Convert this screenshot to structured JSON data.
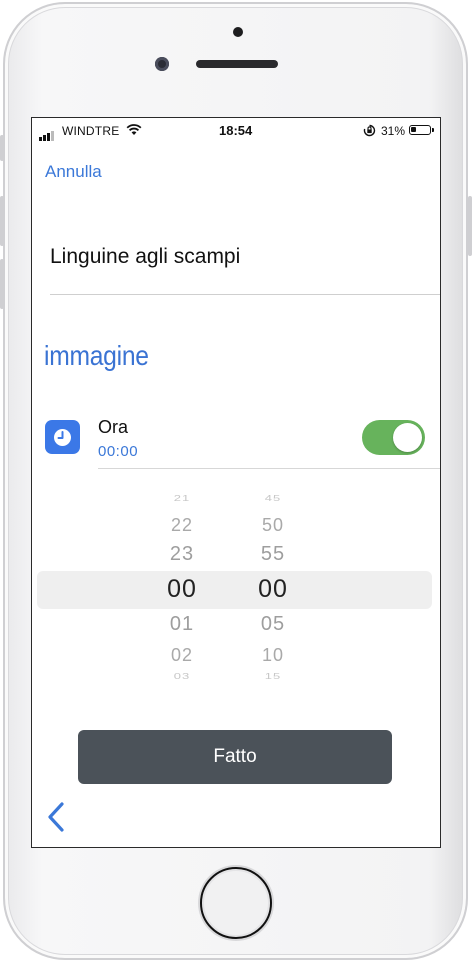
{
  "status_bar": {
    "carrier": "WINDTRE",
    "time": "18:54",
    "battery": "31%",
    "battery_level": 0.31
  },
  "header": {
    "cancel_label": "Annulla"
  },
  "form": {
    "title": "Linguine agli scampi",
    "image_label": "immagine",
    "time_row": {
      "label": "Ora",
      "value": "00:00",
      "icon": "clock-icon",
      "toggle_on": true
    }
  },
  "picker": {
    "hours": [
      "21",
      "22",
      "23",
      "00",
      "01",
      "02",
      "03"
    ],
    "minutes": [
      "45",
      "50",
      "55",
      "00",
      "05",
      "10",
      "15"
    ]
  },
  "done_label": "Fatto",
  "colors": {
    "accent": "#3b78d8",
    "toggle_on": "#67b35c",
    "button_bg": "#4b5259"
  }
}
